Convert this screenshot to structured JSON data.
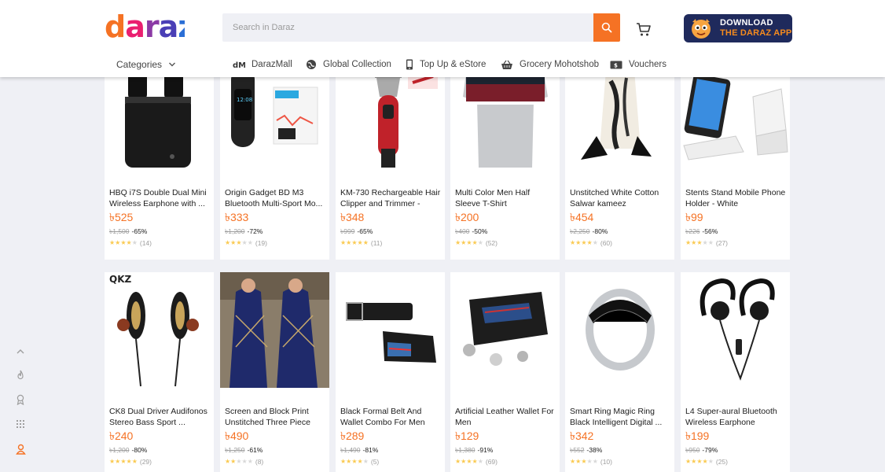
{
  "header": {
    "logo_text": "daraz",
    "search_placeholder": "Search in Daraz",
    "app_banner_line1": "DOWNLOAD",
    "app_banner_line2": "THE DARAZ APP"
  },
  "nav": {
    "categories_label": "Categories",
    "items": [
      {
        "label": "DarazMall"
      },
      {
        "label": "Global Collection"
      },
      {
        "label": "Top Up & eStore"
      },
      {
        "label": "Grocery Mohotshob"
      },
      {
        "label": "Vouchers"
      }
    ]
  },
  "products": [
    {
      "name": "HBQ i7S Double Dual Mini Wireless Earphone with ...",
      "price": "৳525",
      "original": "৳1,500",
      "discount": "-65%",
      "stars": 3.5,
      "reviews": "(14)"
    },
    {
      "name": "Origin Gadget BD M3 Bluetooth Multi-Sport Mo...",
      "price": "৳333",
      "original": "৳1,200",
      "discount": "-72%",
      "stars": 2.5,
      "reviews": "(19)"
    },
    {
      "name": "KM-730 Rechargeable Hair Clipper and Trimmer - Bla...",
      "price": "৳348",
      "original": "৳999",
      "discount": "-65%",
      "stars": 4.5,
      "reviews": "(11)"
    },
    {
      "name": "Multi Color Men Half Sleeve T-Shirt",
      "price": "৳200",
      "original": "৳400",
      "discount": "-50%",
      "stars": 4,
      "reviews": "(52)"
    },
    {
      "name": "Unstitched White Cotton Salwar kameez",
      "price": "৳454",
      "original": "৳2,250",
      "discount": "-80%",
      "stars": 3.5,
      "reviews": "(60)"
    },
    {
      "name": "Stents Stand Mobile Phone Holder - White",
      "price": "৳99",
      "original": "৳226",
      "discount": "-56%",
      "stars": 3,
      "reviews": "(27)"
    },
    {
      "name": "CK8 Dual Driver Audifonos Stereo Bass Sport ...",
      "price": "৳240",
      "original": "৳1,200",
      "discount": "-80%",
      "stars": 4.5,
      "reviews": "(29)"
    },
    {
      "name": "Screen and Block Print Unstitched Three Piece Fo...",
      "price": "৳490",
      "original": "৳1,250",
      "discount": "-61%",
      "stars": 2,
      "reviews": "(8)"
    },
    {
      "name": "Black Formal Belt And Wallet Combo For Men",
      "price": "৳289",
      "original": "৳1,490",
      "discount": "-81%",
      "stars": 4,
      "reviews": "(5)"
    },
    {
      "name": "Artificial Leather Wallet For Men",
      "price": "৳129",
      "original": "৳1,380",
      "discount": "-91%",
      "stars": 3.5,
      "reviews": "(69)"
    },
    {
      "name": "Smart Ring Magic Ring Black Intelligent Digital ...",
      "price": "৳342",
      "original": "৳552",
      "discount": "-38%",
      "stars": 3,
      "reviews": "(10)"
    },
    {
      "name": "L4 Super-aural Bluetooth Wireless Earphone",
      "price": "৳199",
      "original": "৳950",
      "discount": "-79%",
      "stars": 4,
      "reviews": "(25)"
    }
  ],
  "colors": {
    "accent": "#f57224",
    "star": "#faca51",
    "background": "#eff0f5"
  },
  "side_tools": [
    {
      "icon": "chevron-up-icon"
    },
    {
      "icon": "fire-icon"
    },
    {
      "icon": "award-icon"
    },
    {
      "icon": "grid-icon"
    },
    {
      "icon": "user-icon"
    }
  ]
}
